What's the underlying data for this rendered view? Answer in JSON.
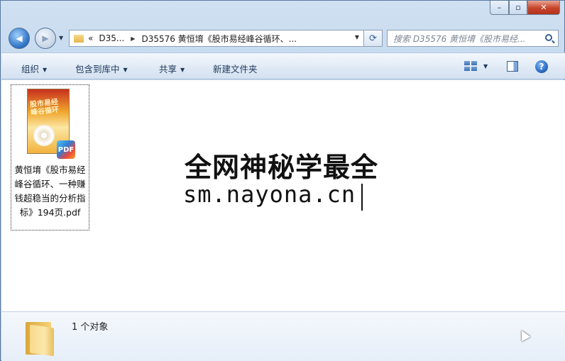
{
  "window": {
    "controls": {
      "minimize": "–",
      "maximize": "▫",
      "close": "✕"
    }
  },
  "address": {
    "overflow": "«",
    "segments": [
      "D35...",
      "D35576 黄恒堉《股市易经峰谷循环、..."
    ]
  },
  "search": {
    "placeholder": "搜索 D35576 黄恒堉《股市易经..."
  },
  "toolbar": {
    "organize": "组织",
    "include_in_library": "包含到库中",
    "share": "共享",
    "new_folder": "新建文件夹",
    "help": "?"
  },
  "files": [
    {
      "name": "黄恒堉《股市易经峰谷循环、一种赚钱超稳当的分析指标》194页.pdf",
      "thumb_title": "股市易经 峰谷循环",
      "badge": "PDF"
    }
  ],
  "watermark": {
    "line1": "全网神秘学最全",
    "line2": "sm.nayona.cn"
  },
  "details": {
    "count_text": "1 个对象"
  }
}
